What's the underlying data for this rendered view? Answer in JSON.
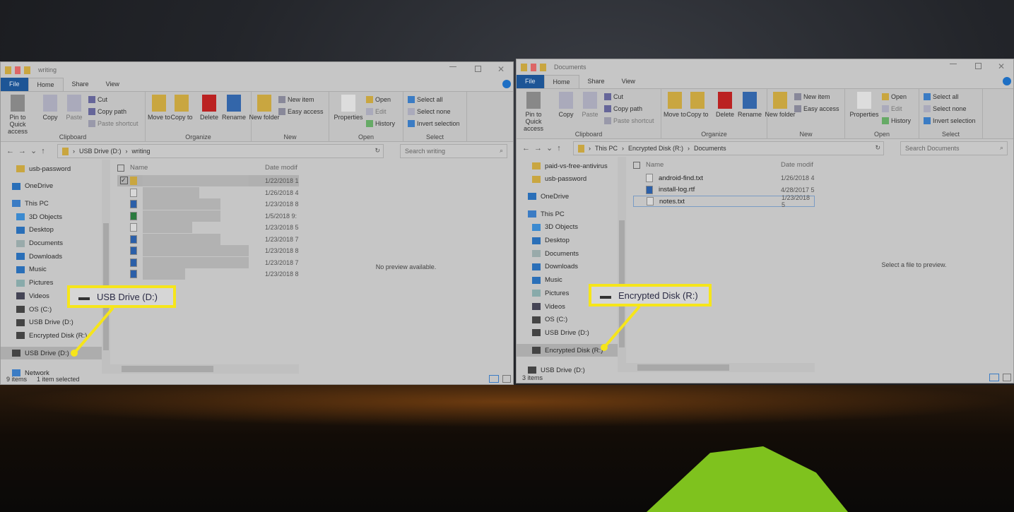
{
  "colors": {
    "callout": "#f6e51a",
    "file_tab": "#1d5596",
    "tent": "#7fc21e"
  },
  "windows": [
    {
      "title": "writing",
      "tabs": [
        "File",
        "Home",
        "Share",
        "View"
      ],
      "ribbon": {
        "clipboard": {
          "label": "Clipboard",
          "pin": "Pin to Quick access",
          "copy": "Copy",
          "paste": "Paste",
          "cut": "Cut",
          "copy_path": "Copy path",
          "paste_shortcut": "Paste shortcut"
        },
        "organize": {
          "label": "Organize",
          "move": "Move to",
          "copy": "Copy to",
          "delete": "Delete",
          "rename": "Rename"
        },
        "new": {
          "label": "New",
          "folder": "New folder",
          "item": "New item",
          "easy": "Easy access"
        },
        "open": {
          "label": "Open",
          "properties": "Properties",
          "open": "Open",
          "edit": "Edit",
          "history": "History"
        },
        "select": {
          "label": "Select",
          "all": "Select all",
          "none": "Select none",
          "invert": "Invert selection"
        }
      },
      "breadcrumb": [
        "USB Drive (D:)",
        "writing"
      ],
      "search_placeholder": "Search writing",
      "nav": [
        {
          "label": "usb-password",
          "icon": "folder-icon"
        },
        {
          "label": "OneDrive",
          "icon": "cloud-icon"
        },
        {
          "label": "This PC",
          "icon": "computer-icon"
        },
        {
          "label": "3D Objects",
          "icon": "cube-icon"
        },
        {
          "label": "Desktop",
          "icon": "desktop-icon"
        },
        {
          "label": "Documents",
          "icon": "document-icon"
        },
        {
          "label": "Downloads",
          "icon": "download-icon"
        },
        {
          "label": "Music",
          "icon": "music-icon"
        },
        {
          "label": "Pictures",
          "icon": "picture-icon"
        },
        {
          "label": "Videos",
          "icon": "video-icon"
        },
        {
          "label": "OS (C:)",
          "icon": "drive-icon"
        },
        {
          "label": "USB Drive (D:)",
          "icon": "drive-icon"
        },
        {
          "label": "Encrypted Disk (R:)",
          "icon": "drive-icon"
        },
        {
          "label": "USB Drive (D:)",
          "icon": "drive-icon",
          "selected": true
        },
        {
          "label": "Network",
          "icon": "network-icon"
        }
      ],
      "columns": {
        "name": "Name",
        "date": "Date modif"
      },
      "files": [
        {
          "name": "",
          "type": "folder",
          "date": "1/22/2018 1",
          "checked": true
        },
        {
          "name": "",
          "type": "txt",
          "date": "1/26/2018 4"
        },
        {
          "name": "",
          "type": "word",
          "date": "1/23/2018 8"
        },
        {
          "name": "",
          "type": "excel",
          "date": "1/5/2018 9:"
        },
        {
          "name": "",
          "type": "txt",
          "date": "1/23/2018 5"
        },
        {
          "name": "",
          "type": "word",
          "date": "1/23/2018 7"
        },
        {
          "name": "",
          "type": "word",
          "date": "1/23/2018 8"
        },
        {
          "name": "",
          "type": "word",
          "date": "1/23/2018 7"
        },
        {
          "name": "",
          "type": "word",
          "date": "1/23/2018 8"
        }
      ],
      "preview_text": "No preview available.",
      "status": [
        "9 items",
        "1 item selected"
      ],
      "callout": "USB Drive (D:)"
    },
    {
      "title": "Documents",
      "tabs": [
        "File",
        "Home",
        "Share",
        "View"
      ],
      "ribbon": {
        "clipboard": {
          "label": "Clipboard",
          "pin": "Pin to Quick access",
          "copy": "Copy",
          "paste": "Paste",
          "cut": "Cut",
          "copy_path": "Copy path",
          "paste_shortcut": "Paste shortcut"
        },
        "organize": {
          "label": "Organize",
          "move": "Move to",
          "copy": "Copy to",
          "delete": "Delete",
          "rename": "Rename"
        },
        "new": {
          "label": "New",
          "folder": "New folder",
          "item": "New item",
          "easy": "Easy access"
        },
        "open": {
          "label": "Open",
          "properties": "Properties",
          "open": "Open",
          "edit": "Edit",
          "history": "History"
        },
        "select": {
          "label": "Select",
          "all": "Select all",
          "none": "Select none",
          "invert": "Invert selection"
        }
      },
      "breadcrumb": [
        "This PC",
        "Encrypted Disk (R:)",
        "Documents"
      ],
      "search_placeholder": "Search Documents",
      "nav": [
        {
          "label": "paid-vs-free-antivirus",
          "icon": "folder-icon"
        },
        {
          "label": "usb-password",
          "icon": "folder-icon"
        },
        {
          "label": "OneDrive",
          "icon": "cloud-icon"
        },
        {
          "label": "This PC",
          "icon": "computer-icon"
        },
        {
          "label": "3D Objects",
          "icon": "cube-icon"
        },
        {
          "label": "Desktop",
          "icon": "desktop-icon"
        },
        {
          "label": "Documents",
          "icon": "document-icon"
        },
        {
          "label": "Downloads",
          "icon": "download-icon"
        },
        {
          "label": "Music",
          "icon": "music-icon"
        },
        {
          "label": "Pictures",
          "icon": "picture-icon"
        },
        {
          "label": "Videos",
          "icon": "video-icon"
        },
        {
          "label": "OS (C:)",
          "icon": "drive-icon"
        },
        {
          "label": "USB Drive (D:)",
          "icon": "drive-icon"
        },
        {
          "label": "Encrypted Disk (R:)",
          "icon": "drive-icon",
          "selected": true
        },
        {
          "label": "USB Drive (D:)",
          "icon": "drive-icon"
        }
      ],
      "columns": {
        "name": "Name",
        "date": "Date modif"
      },
      "files": [
        {
          "name": "android-find.txt",
          "type": "txt",
          "date": "1/26/2018 4"
        },
        {
          "name": "install-log.rtf",
          "type": "word",
          "date": "4/28/2017 5"
        },
        {
          "name": "notes.txt",
          "type": "txt",
          "date": "1/23/2018 5",
          "focused": true
        }
      ],
      "preview_text": "Select a file to preview.",
      "status": [
        "3 items"
      ],
      "callout": "Encrypted Disk (R:)"
    }
  ]
}
